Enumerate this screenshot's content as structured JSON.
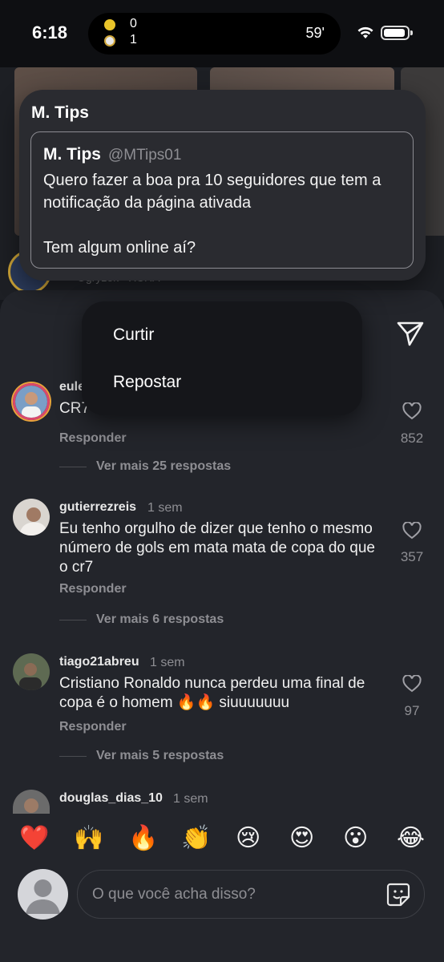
{
  "status_bar": {
    "time": "6:18",
    "score_home": "0",
    "score_away": "1",
    "match_minute": "59'"
  },
  "post_card": {
    "title": "M. Tips",
    "quote": {
      "author": "M. Tips",
      "handle": "@MTips01",
      "text": "Quero fazer a boa pra 10 seguidores que tem a notificação da página ativada\n\nTem algum online aí?"
    }
  },
  "background_feed": {
    "caption": "Ogryzek · XCHA"
  },
  "context_menu": {
    "items": [
      {
        "label": "Curtir"
      },
      {
        "label": "Repostar"
      }
    ]
  },
  "comments": [
    {
      "username": "eule",
      "time": "",
      "text": "CR7 n",
      "reply_label": "Responder",
      "likes": "852",
      "more_replies": "Ver mais 25 respostas"
    },
    {
      "username": "gutierrezreis",
      "time": "1 sem",
      "text": "Eu tenho orgulho de dizer que tenho o mesmo número de gols em mata mata de copa do que o cr7",
      "reply_label": "Responder",
      "likes": "357",
      "more_replies": "Ver mais 6 respostas"
    },
    {
      "username": "tiago21abreu",
      "time": "1 sem",
      "text": "Cristiano Ronaldo nunca perdeu uma final de copa é o homem 🔥🔥 siuuuuuuu",
      "reply_label": "Responder",
      "likes": "97",
      "more_replies": "Ver mais 5 respostas"
    },
    {
      "username": "douglas_dias_10",
      "time": "1 sem"
    }
  ],
  "emoji_bar": [
    "❤️",
    "🙌",
    "🔥",
    "👏",
    "😢",
    "😍",
    "😮",
    "😂"
  ],
  "comment_input": {
    "placeholder": "O que você acha disso?"
  },
  "icons": {
    "send": "send-icon",
    "heart": "heart-icon",
    "sticker": "sticker-icon",
    "wifi": "wifi-icon",
    "battery": "battery-icon"
  }
}
